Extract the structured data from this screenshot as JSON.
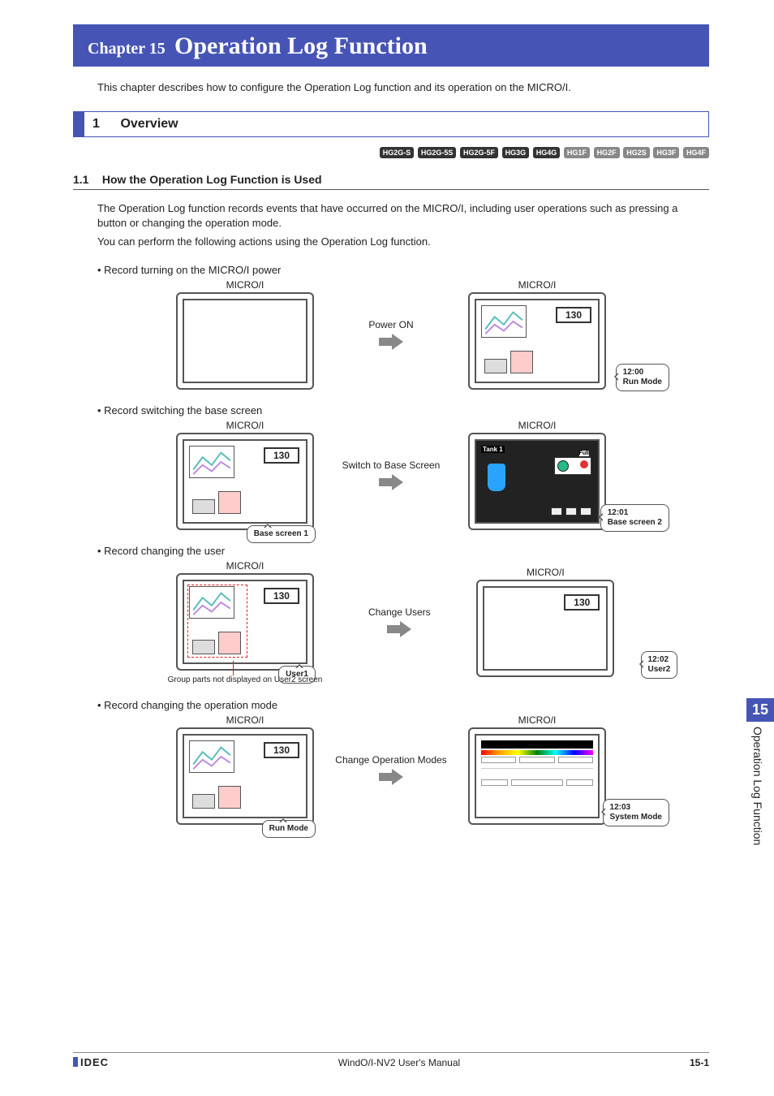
{
  "chapter": {
    "small": "Chapter 15",
    "big": "Operation Log Function"
  },
  "intro": "This chapter describes how to configure the Operation Log function and its operation on the MICRO/I.",
  "section": {
    "num": "1",
    "title": "Overview"
  },
  "badges_dark": [
    "HG2G-S",
    "HG2G-5S",
    "HG2G-5F",
    "HG3G",
    "HG4G"
  ],
  "badges_light": [
    "HG1F",
    "HG2F",
    "HG2S",
    "HG3F",
    "HG4F"
  ],
  "subsection": {
    "num": "1.1",
    "title": "How the Operation Log Function is Used"
  },
  "para1": "The Operation Log function records events that have occurred on the MICRO/I, including user operations such as pressing a button or changing the operation mode.",
  "para2": "You can perform the following actions using the Operation Log function.",
  "bullets": {
    "b1": "Record turning on the MICRO/I power",
    "b2": "Record switching the base screen",
    "b3": "Record changing the user",
    "b4": "Record changing the operation mode"
  },
  "labels": {
    "micro": "MICRO/I",
    "power_on": "Power ON",
    "switch_base": "Switch to Base Screen",
    "change_users": "Change Users",
    "change_modes": "Change Operation Modes",
    "group_note": "Group parts not displayed on User2 screen",
    "tank": "Tank 1",
    "full": "Full",
    "num130": "130"
  },
  "bubbles": {
    "r1": {
      "t": "12:00",
      "s": "Run Mode"
    },
    "l2": "Base screen 1",
    "r2": {
      "t": "12:01",
      "s": "Base screen 2"
    },
    "l3": "User1",
    "r3": {
      "t": "12:02",
      "s": "User2"
    },
    "l4": "Run Mode",
    "r4": {
      "t": "12:03",
      "s": "System Mode"
    }
  },
  "side_tab": {
    "num": "15",
    "text": "Operation Log Function"
  },
  "footer": {
    "logo": "IDEC",
    "center": "WindO/I-NV2 User's Manual",
    "page": "15-1"
  }
}
